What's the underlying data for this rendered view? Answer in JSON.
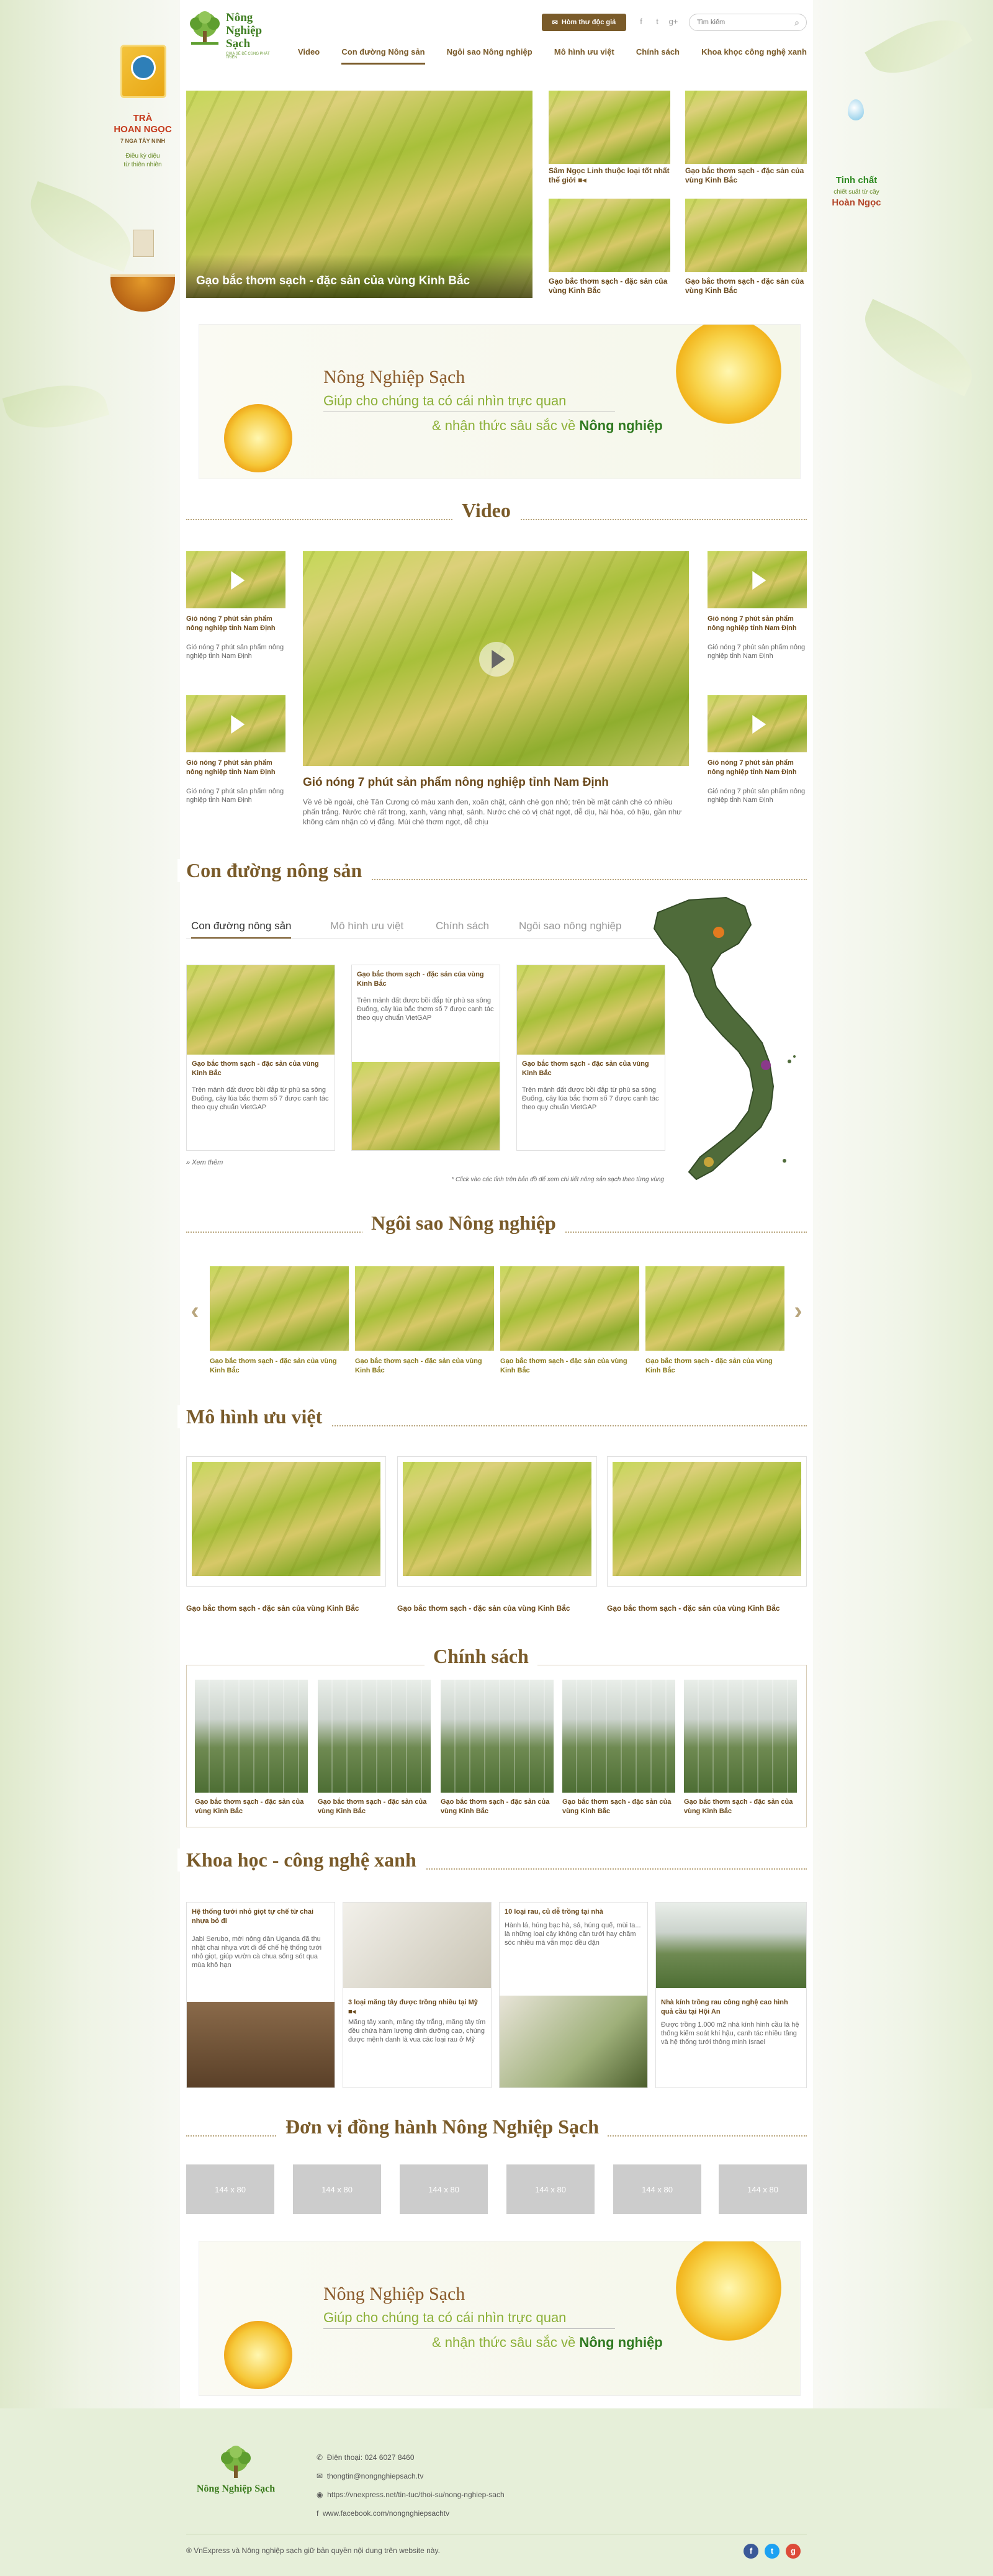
{
  "header": {
    "logo_name_1": "Nông",
    "logo_name_2": "Nghiệp",
    "logo_name_3": "Sạch",
    "logo_tagline": "CHIA SẺ ĐỂ CÙNG PHÁT TRIỂN",
    "mail_label": "Hòm thư độc giả",
    "search_placeholder": "Tìm kiếm",
    "social": [
      "f",
      "t",
      "g+"
    ]
  },
  "nav": [
    "Video",
    "Con đường Nông sản",
    "Ngôi sao Nông nghiệp",
    "Mô hình ưu việt",
    "Chính sách",
    "Khoa khọc công nghệ xanh"
  ],
  "left_ad": {
    "brand_1": "TRÀ",
    "brand_2": "HOAN NGỌC",
    "brand_3": "7 NGA TÂY NINH",
    "tag_1": "Điều kỳ diệu",
    "tag_2": "từ thiên nhiên"
  },
  "right_ad": {
    "line1": "Tinh chất",
    "line2": "chiết suất từ cây",
    "line3": "Hoàn Ngọc"
  },
  "hero": {
    "main_caption": "Gạo bắc thơm sạch - đặc sản của vùng Kinh Bắc",
    "items": [
      "Sâm Ngọc Linh thuộc loại tốt nhất thế giới",
      "Gạo bắc thơm sạch - đặc sản của vùng Kinh Bắc",
      "Gạo bắc thơm sạch - đặc sản của vùng Kinh Bắc",
      "Gạo bắc thơm sạch - đặc sản của vùng Kinh Bắc"
    ]
  },
  "banner": {
    "title": "Nông Nghiệp Sạch",
    "line1": "Giúp cho chúng ta có cái nhìn trực quan",
    "line2_prefix": "& nhận thức sâu sắc về",
    "line2_strong": "Nông nghiệp"
  },
  "video": {
    "title": "Video",
    "side_title": "Gió nóng 7 phút sản phẩm nông nghiệp tỉnh Nam Định",
    "side_desc": "Gió nóng 7 phút sản phẩm nông nghiệp tỉnh Nam Định",
    "main_title": "Gió nóng 7 phút sản phẩm nông nghiệp tỉnh Nam Định",
    "main_desc": "Về vẻ bề ngoài, chè Tân Cương có màu xanh đen, xoăn chặt, cánh chè gọn nhỏ; trên bề mặt cánh chè có nhiều phấn trắng. Nước chè rất trong, xanh, vàng nhạt, sánh. Nước chè có vị chát ngọt, dễ dịu, hài hòa, có hậu, gần như không cảm nhận có vị đắng. Mùi chè thơm ngọt, dễ chịu"
  },
  "con_duong": {
    "title": "Con đường nông sản",
    "tabs": [
      "Con đường nông sản",
      "Mô hình ưu việt",
      "Chính sách",
      "Ngôi sao nông nghiệp"
    ],
    "card_title": "Gạo bắc thơm sạch - đặc sản của vùng Kinh Bắc",
    "card_desc": "Trên mảnh đất được bồi đắp từ phù sa sông Đuống, cây lúa bắc thơm số 7 được canh tác theo quy chuẩn VietGAP",
    "more": "» Xem thêm",
    "map_note": "* Click vào các tỉnh trên bản đồ để xem chi tiết nông sản sạch theo từng vùng"
  },
  "ngoi_sao": {
    "title": "Ngôi sao Nông nghiệp",
    "items": [
      "Gạo bắc thơm sạch - đặc sản của vùng Kinh Bắc",
      "Gạo bắc thơm sạch - đặc sản của vùng Kinh Bắc",
      "Gạo bắc thơm sạch - đặc sản của vùng Kinh Bắc",
      "Gạo bắc thơm sạch - đặc sản của vùng Kinh Bắc"
    ]
  },
  "mo_hinh": {
    "title": "Mô hình ưu việt",
    "items": [
      "Gạo bắc thơm sạch - đặc sản của vùng Kinh Bắc",
      "Gạo bắc thơm sạch - đặc sản của vùng Kinh Bắc",
      "Gạo bắc thơm sạch - đặc sản của vùng Kinh Bắc"
    ]
  },
  "chinh_sach": {
    "title": "Chính sách",
    "items": [
      "Gạo bắc thơm sạch - đặc sản của vùng Kinh Bắc",
      "Gạo bắc thơm sạch - đặc sản của vùng Kinh Bắc",
      "Gạo bắc thơm sạch - đặc sản của vùng Kinh Bắc",
      "Gạo bắc thơm sạch - đặc sản của vùng Kinh Bắc",
      "Gạo bắc thơm sạch - đặc sản của vùng Kinh Bắc"
    ]
  },
  "khoa_hoc": {
    "title": "Khoa học - công nghệ xanh",
    "a1_title": "Hệ thống tưới nhỏ giọt tự chế từ chai nhựa bỏ đi",
    "a1_desc": "Jabi Serubo, mời nông dân Uganda đã thu nhặt chai nhựa vứt đi để chế hệ thống tưới nhỏ giọt, giúp vườn cà chua sống sót qua mùa khô hạn",
    "a2_title": "3 loại măng tây được trồng nhiều tại Mỹ",
    "a2_desc": "Măng tây xanh, măng tây trắng, măng tây tím đều chứa hàm lượng dinh dưỡng cao, chúng được mệnh danh là vua các loại rau ở Mỹ",
    "a3_title": "10 loại rau, củ dễ trồng tại nhà",
    "a3_desc": "Hành lá, húng bạc hà, sả, húng quế, mùi ta... là những loại cây không cần tưới hay chăm sóc nhiều mà vẫn mọc đều đặn",
    "a4_title": "Nhà kính trồng rau công nghệ cao hình quả cầu tại Hội An",
    "a4_desc": "Được trồng 1.000 m2 nhà kính hình cầu là hệ thống kiểm soát khí hậu, canh tác nhiều tầng và hệ thống tưới thông minh Israel"
  },
  "partners": {
    "title": "Đơn vị đồng hành Nông Nghiệp Sạch",
    "items": [
      "144 x 80",
      "144 x 80",
      "144 x 80",
      "144 x 80",
      "144 x 80",
      "144 x 80"
    ]
  },
  "footer": {
    "logo": "Nông Nghiệp Sạch",
    "phone": "Điện thoại: 024 6027 8460",
    "email": "thongtin@nongnghiepsach.tv",
    "link": "https://vnexpress.net/tin-tuc/thoi-su/nong-nghiep-sach",
    "facebook": "www.facebook.com/nongnghiepsachtv",
    "copyright": "® VnExpress và Nông nghiệp sạch giữ bản quyền nội dung trên website này."
  },
  "colors": {
    "brand_brown": "#7a5b2a",
    "brand_green": "#3c7c1e",
    "fb": "#3b5998",
    "tw": "#1da1f2",
    "gp": "#dd4b39"
  }
}
